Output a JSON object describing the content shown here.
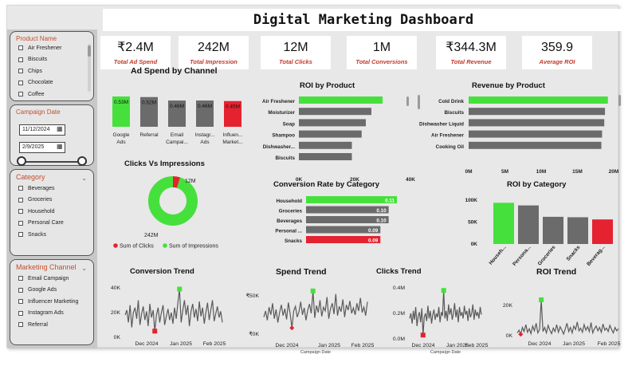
{
  "dashboard": {
    "title": "Digital Marketing Dashboard"
  },
  "colors": {
    "accent_green": "#46e03c",
    "accent_red": "#e52230",
    "bar_gray": "#6b6b6b",
    "kpi_label": "#c0392b",
    "slicer_title": "#c0502f"
  },
  "slicers": {
    "product": {
      "title": "Product Name",
      "items": [
        "Air Freshener",
        "Biscuits",
        "Chips",
        "Chocolate",
        "Coffee"
      ]
    },
    "campaign_date": {
      "title": "Campaign Date",
      "start": "11/12/2024",
      "end": "2/9/2025"
    },
    "category": {
      "title": "Category",
      "items": [
        "Beverages",
        "Groceries",
        "Household",
        "Personal Care",
        "Snacks"
      ]
    },
    "marketing_channel": {
      "title": "Marketing Channel",
      "items": [
        "Email Campaign",
        "Google Ads",
        "Influencer Marketing",
        "Instagram Ads",
        "Referral"
      ]
    }
  },
  "kpis": [
    {
      "value": "₹2.4M",
      "label": "Total Ad Spend"
    },
    {
      "value": "242M",
      "label": "Total Impression"
    },
    {
      "value": "12M",
      "label": "Total Clicks"
    },
    {
      "value": "1M",
      "label": "Total Conversions"
    },
    {
      "value": "₹344.3M",
      "label": "Total Revenue"
    },
    {
      "value": "359.9",
      "label": "Average ROI"
    }
  ],
  "chart_data": [
    {
      "id": "ad_spend",
      "type": "bar",
      "title": "Ad Spend by Channel",
      "categories": [
        "Google Ads",
        "Referral",
        "Email Campai...",
        "Instagr... Ads",
        "Influen... Market..."
      ],
      "category_lines": [
        [
          "Google",
          "Ads"
        ],
        [
          "Referral"
        ],
        [
          "Email",
          "Campai..."
        ],
        [
          "Instagr...",
          "Ads"
        ],
        [
          "Influen...",
          "Market..."
        ]
      ],
      "values": [
        0.53,
        0.52,
        0.46,
        0.46,
        0.45
      ],
      "data_labels": [
        "0.53M",
        "0.52M",
        "0.46M",
        "0.46M",
        "0.45M"
      ],
      "bar_colors": [
        "#46e03c",
        "#6b6b6b",
        "#6b6b6b",
        "#6b6b6b",
        "#e52230"
      ],
      "ylim": [
        0,
        0.53
      ]
    },
    {
      "id": "roi_product",
      "type": "bar",
      "orientation": "horizontal",
      "title": "ROI by Product",
      "categories": [
        "Air Freshener",
        "Moisturizer",
        "Soap",
        "Shampoo",
        "Dishwasher...",
        "Biscuits"
      ],
      "values": [
        30000,
        26000,
        24000,
        22500,
        19000,
        19000
      ],
      "xticks": [
        "0K",
        "20K",
        "40K"
      ],
      "xlim": [
        0,
        40000
      ]
    },
    {
      "id": "revenue_product",
      "type": "bar",
      "orientation": "horizontal",
      "title": "Revenue by Product",
      "categories": [
        "Cold Drink",
        "Biscuits",
        "Dishwasher Liquid",
        "Air Freshener",
        "Cooking Oil"
      ],
      "values": [
        19200000,
        18800000,
        18700000,
        18400000,
        18300000
      ],
      "xticks": [
        "0M",
        "5M",
        "10M",
        "15M",
        "20M"
      ],
      "xlim": [
        0,
        20000000
      ]
    },
    {
      "id": "clicks_impressions",
      "type": "pie",
      "title": "Clicks Vs Impressions",
      "labels": [
        "Sum of Clicks",
        "Sum of Impressions"
      ],
      "values": [
        12,
        242
      ],
      "data_labels": [
        "12M",
        "242M"
      ],
      "colors": [
        "#e52230",
        "#46e03c"
      ]
    },
    {
      "id": "conversion_category",
      "type": "bar",
      "orientation": "horizontal",
      "title": "Conversion Rate by Category",
      "categories": [
        "Household",
        "Groceries",
        "Beverages",
        "Personal ...",
        "Snacks"
      ],
      "values": [
        0.11,
        0.1,
        0.1,
        0.09,
        0.09
      ],
      "data_labels": [
        "0.11",
        "0.10",
        "0.10",
        "0.09",
        "0.09"
      ],
      "bar_colors": [
        "#46e03c",
        "#6b6b6b",
        "#6b6b6b",
        "#6b6b6b",
        "#e52230"
      ],
      "xlim": [
        0,
        0.11
      ]
    },
    {
      "id": "roi_category",
      "type": "bar",
      "title": "ROI by Category",
      "categories": [
        "Househ...",
        "Persona...",
        "Groceries",
        "Snacks",
        "Beverag..."
      ],
      "values": [
        94000,
        88000,
        62000,
        61000,
        56000
      ],
      "bar_colors": [
        "#46e03c",
        "#6b6b6b",
        "#6b6b6b",
        "#6b6b6b",
        "#e52230"
      ],
      "yticks": [
        "100K",
        "50K",
        "0K"
      ],
      "ylim": [
        0,
        100000
      ]
    },
    {
      "id": "conversion_trend",
      "type": "line",
      "title": "Conversion Trend",
      "yticks": [
        "40K",
        "20K",
        "0K"
      ],
      "xticks": [
        "Dec 2024",
        "Jan 2025",
        "Feb 2025"
      ],
      "ylim": [
        0,
        40000
      ],
      "values": [
        18000,
        22000,
        12000,
        26000,
        8000,
        20000,
        24000,
        15000,
        30000,
        10000,
        19000,
        25000,
        14000,
        21000,
        9000,
        27000,
        16000,
        22000,
        5000,
        18000,
        24000,
        12000,
        20000,
        26000,
        10000,
        17000,
        23000,
        14000,
        20000,
        11000,
        24000,
        15000,
        28000,
        39000,
        12000,
        22000,
        30000,
        18000,
        26000,
        9000,
        21000,
        27000,
        16000,
        23000,
        13000,
        29000,
        17000,
        24000,
        11000,
        20000,
        28000,
        14000,
        22000,
        30000,
        13000,
        19000,
        25000,
        16000,
        21000,
        12000
      ]
    },
    {
      "id": "spend_trend",
      "type": "line",
      "title": "Spend Trend",
      "yticks": [
        "₹50K",
        "₹0K"
      ],
      "xticks": [
        "Dec 2024",
        "Jan 2025",
        "Feb 2025"
      ],
      "xlabel": "Campaign Date",
      "ylim": [
        0,
        60000
      ],
      "values": [
        22000,
        30000,
        18000,
        35000,
        25000,
        40000,
        20000,
        32000,
        15000,
        28000,
        38000,
        24000,
        33000,
        19000,
        41000,
        26000,
        8000,
        30000,
        36000,
        22000,
        29000,
        42000,
        25000,
        34000,
        18000,
        31000,
        39000,
        27000,
        56000,
        21000,
        37000,
        28000,
        44000,
        23000,
        35000,
        30000,
        48000,
        20000,
        33000,
        40000,
        26000,
        52000,
        24000,
        36000,
        29000,
        45000,
        22000,
        38000,
        31000,
        43000,
        27000,
        34000,
        25000,
        40000,
        30000,
        47000,
        28000,
        35000,
        24000,
        42000
      ]
    },
    {
      "id": "clicks_trend",
      "type": "line",
      "title": "Clicks Trend",
      "yticks": [
        "0.4M",
        "0.2M",
        "0.0M"
      ],
      "xticks": [
        "Dec 2024",
        "Jan 2025",
        "Feb 2025"
      ],
      "xlabel": "Campaign Date",
      "ylim": [
        0,
        0.4
      ],
      "values": [
        0.16,
        0.2,
        0.12,
        0.22,
        0.15,
        0.25,
        0.1,
        0.18,
        0.21,
        0.13,
        0.24,
        0.03,
        0.17,
        0.2,
        0.14,
        0.26,
        0.16,
        0.22,
        0.12,
        0.19,
        0.23,
        0.15,
        0.2,
        0.17,
        0.25,
        0.13,
        0.21,
        0.18,
        0.38,
        0.16,
        0.22,
        0.14,
        0.27,
        0.19,
        0.24,
        0.15,
        0.2,
        0.28,
        0.17,
        0.23,
        0.13,
        0.25,
        0.18,
        0.21,
        0.16,
        0.26,
        0.19,
        0.22,
        0.14,
        0.24,
        0.17,
        0.2,
        0.27,
        0.15,
        0.23,
        0.18,
        0.21,
        0.16,
        0.25,
        0.19
      ]
    },
    {
      "id": "roi_trend",
      "type": "line",
      "title": "ROI Trend",
      "yticks": [
        "20K",
        "0K"
      ],
      "xticks": [
        "Dec 2024",
        "Jan 2025",
        "Feb 2025"
      ],
      "ylim": [
        0,
        30000
      ],
      "values": [
        2000,
        4000,
        1000,
        6000,
        3000,
        8000,
        2500,
        5000,
        1500,
        7000,
        3500,
        9000,
        2000,
        4500,
        26000,
        3000,
        6000,
        2000,
        7500,
        4000,
        1500,
        5500,
        3000,
        8000,
        2500,
        6500,
        4000,
        1200,
        5000,
        9000,
        3000,
        6000,
        2000,
        7000,
        4500,
        10000,
        3500,
        5500,
        2500,
        8000,
        4000,
        6500,
        3000,
        9500,
        2000,
        5000,
        7000,
        3500,
        6000,
        2500,
        8500,
        4000,
        5500,
        3000,
        7500,
        4500,
        2000,
        6000,
        3500,
        5000
      ]
    }
  ]
}
